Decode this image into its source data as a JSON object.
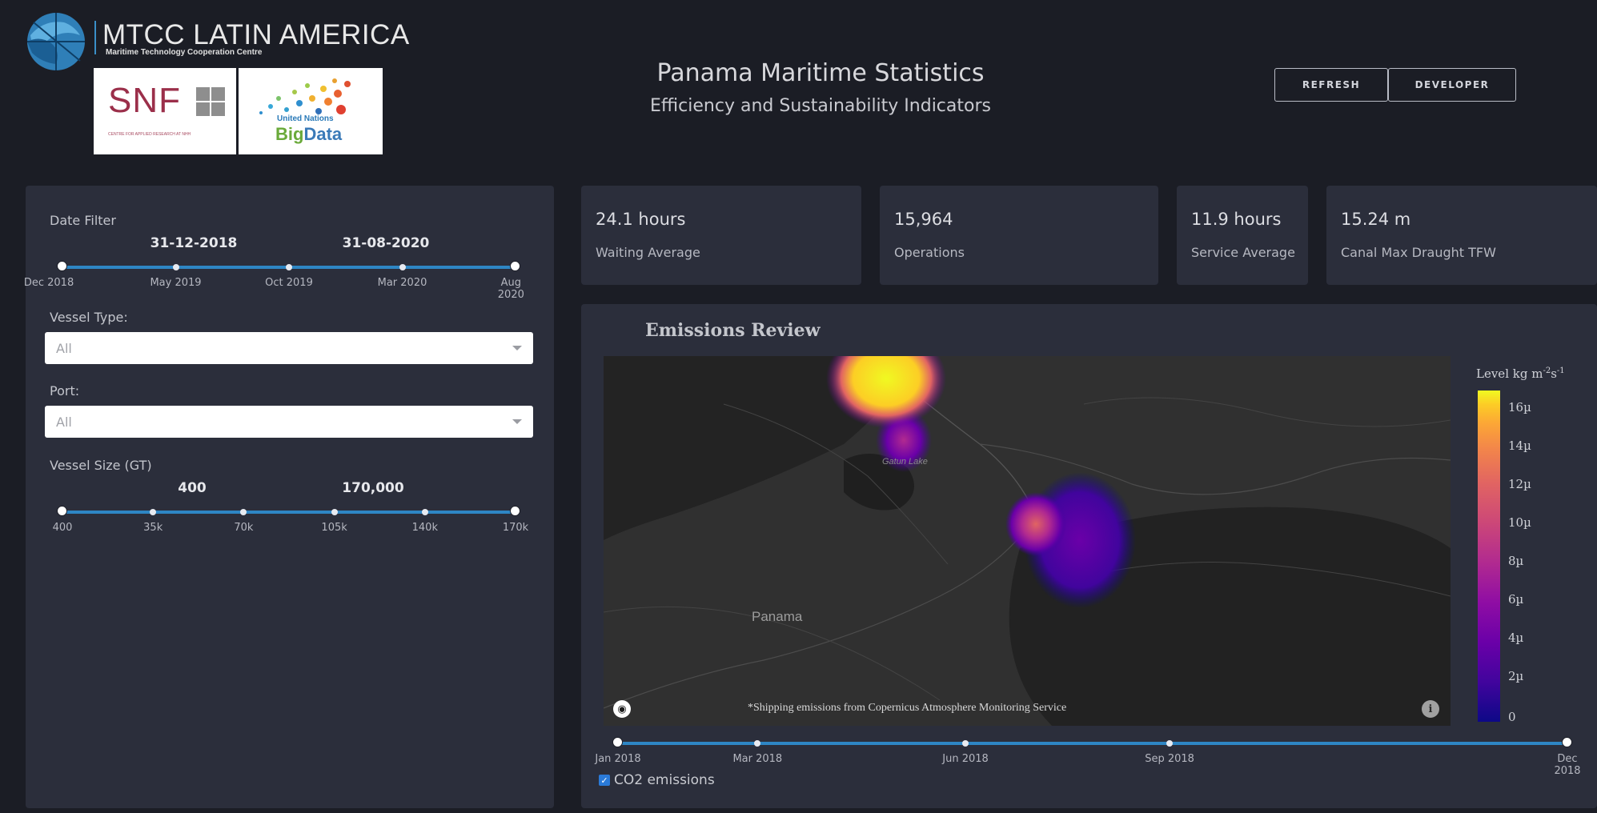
{
  "header": {
    "org_name": "MTCC LATIN AMERICA",
    "org_subtitle": "Maritime Technology Cooperation Centre",
    "partner_snf": "SNF",
    "partner_snf_sub": "CENTRE FOR APPLIED RESEARCH AT NHH",
    "partner_un": "United Nations",
    "partner_bigdata_1": "Big",
    "partner_bigdata_2": "Data",
    "title": "Panama Maritime Statistics",
    "subtitle": "Efficiency and Sustainability Indicators",
    "refresh_label": "REFRESH",
    "developer_label": "DEVELOPER"
  },
  "filters": {
    "date": {
      "label": "Date Filter",
      "start_value": "31-12-2018",
      "end_value": "31-08-2020",
      "marks": [
        "Dec 2018",
        "May 2019",
        "Oct 2019",
        "Mar 2020",
        "Aug 2020"
      ]
    },
    "vessel_type": {
      "label": "Vessel Type:",
      "value": "All"
    },
    "port": {
      "label": "Port:",
      "value": "All"
    },
    "vessel_size": {
      "label": "Vessel Size (GT)",
      "start_value": "400",
      "end_value": "170,000",
      "marks": [
        "400",
        "35k",
        "70k",
        "105k",
        "140k",
        "170k"
      ]
    }
  },
  "kpis": [
    {
      "value": "24.1 hours",
      "label": "Waiting Average"
    },
    {
      "value": "15,964",
      "label": "Operations"
    },
    {
      "value": "11.9 hours",
      "label": "Service Average"
    },
    {
      "value": "15.24 m",
      "label": "Canal Max Draught TFW"
    }
  ],
  "emissions": {
    "title": "Emissions Review",
    "map_labels": {
      "country": "Panama",
      "lake": "Gatun Lake"
    },
    "credit": "*Shipping emissions from Copernicus Atmosphere Monitoring Service",
    "legend_title": "Level kg m",
    "legend_exp1": "-2",
    "legend_unit": "s",
    "legend_exp2": "-1",
    "legend_ticks": [
      "16µ",
      "14µ",
      "12µ",
      "10µ",
      "8µ",
      "6µ",
      "4µ",
      "2µ",
      "0"
    ],
    "colorscale": [
      "#0d0887",
      "#6a00a8",
      "#b12a90",
      "#e16462",
      "#fca636",
      "#f0f921"
    ],
    "time_marks": [
      "Jan 2018",
      "Mar 2018",
      "Jun 2018",
      "Sep 2018",
      "Dec 2018"
    ],
    "co2_label": "CO2 emissions",
    "co2_checked": true
  }
}
